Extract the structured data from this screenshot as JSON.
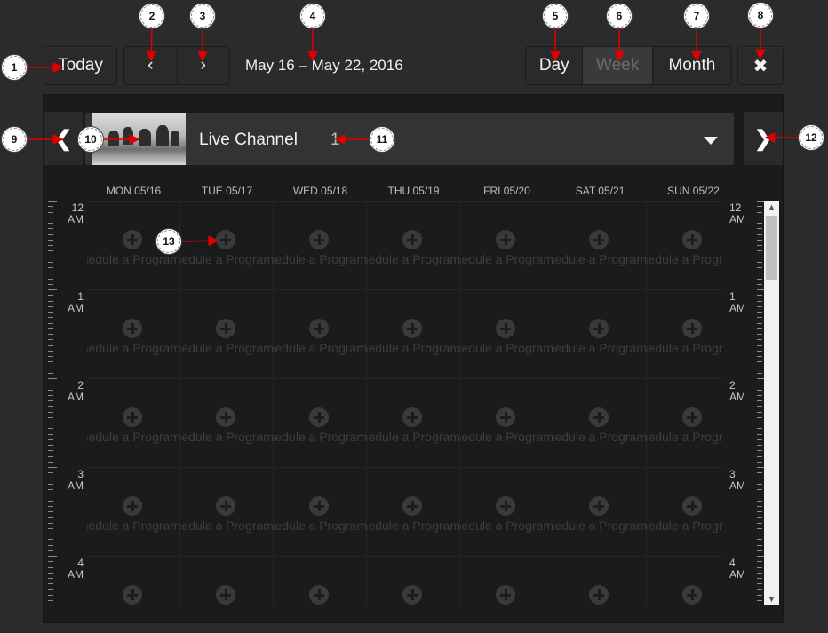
{
  "toolbar": {
    "today_label": "Today",
    "prev_label": "‹",
    "next_label": "›",
    "date_range": "May 16 – May 22, 2016",
    "views": [
      {
        "label": "Day",
        "active": false
      },
      {
        "label": "Week",
        "active": true
      },
      {
        "label": "Month",
        "active": false
      }
    ],
    "close_label": "✖"
  },
  "channel": {
    "title": "Live Channel",
    "number": "1",
    "prev_label": "❮",
    "next_label": "❯"
  },
  "days": [
    "MON 05/16",
    "TUE 05/17",
    "WED 05/18",
    "THU 05/19",
    "FRI 05/20",
    "SAT 05/21",
    "SUN 05/22"
  ],
  "hours": [
    {
      "num": "12",
      "ampm": "AM"
    },
    {
      "num": "1",
      "ampm": "AM"
    },
    {
      "num": "2",
      "ampm": "AM"
    },
    {
      "num": "3",
      "ampm": "AM"
    },
    {
      "num": "4",
      "ampm": "AM"
    }
  ],
  "cell_text": "Schedule a Program",
  "callouts": [
    "1",
    "2",
    "3",
    "4",
    "5",
    "6",
    "7",
    "8",
    "9",
    "10",
    "11",
    "12",
    "13"
  ],
  "colors": {
    "callout_arrow": "#e00000",
    "background": "#2b2b2b",
    "panel": "#1b1b1b"
  }
}
